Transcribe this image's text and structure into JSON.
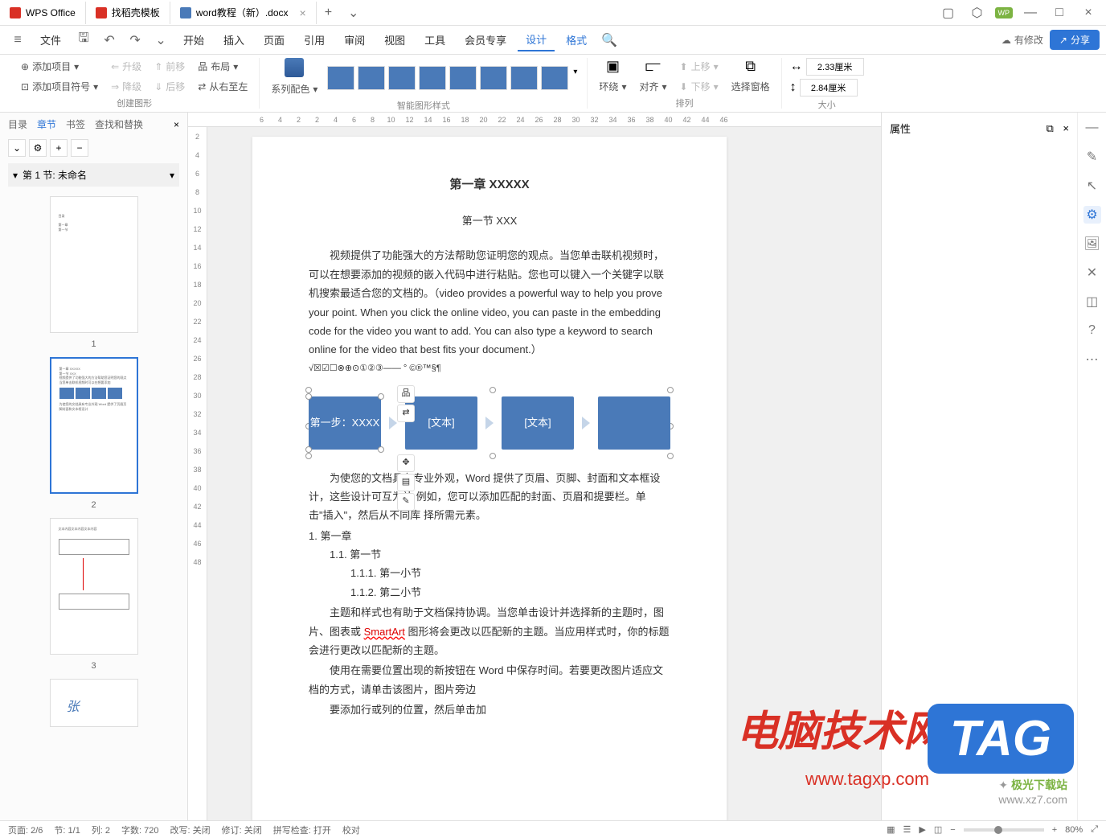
{
  "titlebar": {
    "tabs": [
      {
        "label": "WPS Office",
        "icon": "wps"
      },
      {
        "label": "找稻壳模板",
        "icon": "template"
      },
      {
        "label": "word教程（新）.docx",
        "icon": "word",
        "active": true
      }
    ],
    "wp": "WP"
  },
  "menubar": {
    "file": "文件",
    "items": [
      "开始",
      "插入",
      "页面",
      "引用",
      "审阅",
      "视图",
      "工具",
      "会员专享",
      "设计",
      "格式"
    ],
    "active": "设计",
    "modify": "有修改",
    "share": "分享"
  },
  "ribbon": {
    "group_create": "创建图形",
    "add_item": "添加项目",
    "add_bullet": "添加项目符号",
    "promote": "升级",
    "demote": "降级",
    "move_before": "前移",
    "move_after": "后移",
    "layout": "布局",
    "rtl": "从右至左",
    "group_style": "智能图形样式",
    "series_color": "系列配色",
    "group_arrange": "排列",
    "wrap": "环绕",
    "align": "对齐",
    "move_up": "上移",
    "move_down": "下移",
    "select_pane": "选择窗格",
    "group_size": "大小",
    "width": "2.33厘米",
    "height": "2.84厘米"
  },
  "left_panel": {
    "tabs": [
      "目录",
      "章节",
      "书签",
      "查找和替换"
    ],
    "active": "章节",
    "section1": "第 1 节: 未命名",
    "pages": [
      "1",
      "2",
      "3"
    ]
  },
  "ruler_h": [
    "6",
    "4",
    "2",
    "2",
    "4",
    "6",
    "8",
    "10",
    "12",
    "14",
    "16",
    "18",
    "20",
    "22",
    "24",
    "26",
    "28",
    "30",
    "32",
    "34",
    "36",
    "38",
    "40",
    "42",
    "44",
    "46"
  ],
  "ruler_v": [
    "2",
    "4",
    "6",
    "8",
    "10",
    "12",
    "14",
    "16",
    "18",
    "20",
    "22",
    "24",
    "26",
    "28",
    "30",
    "32",
    "34",
    "36",
    "38",
    "40",
    "42",
    "44",
    "46",
    "48"
  ],
  "doc": {
    "ch1": "第一章 XXXXX",
    "sec1": "第一节 XXX",
    "p1": "视频提供了功能强大的方法帮助您证明您的观点。当您单击联机视频时，可以在想要添加的视频的嵌入代码中进行粘贴。您也可以键入一个关键字以联机搜索最适合您的文档的。（video provides a powerful way to help you prove your point. When you click the online video, you can paste in the embedding code for the video you want to add. You can also type a keyword to search online for the video that best fits your document.）",
    "symbols": "√☒☑☐⊗⊕⊙①②③——  °  ©®™§¶",
    "box1": "第一步：XXXX",
    "box2": "[文本]",
    "box3": "[文本]",
    "p2": "为使您的文档具有专业外观，Word 提供了页眉、页脚、封面和文本框设计，这些设计可互为补    例如，您可以添加匹配的封面、页眉和提要栏。单击\"插入\"，然后从不同库    择所需元素。",
    "l1": "1.  第一章",
    "l11": "1.1. 第一节",
    "l111": "1.1.1. 第一小节",
    "l112": "1.1.2. 第二小节",
    "p3": "主题和样式也有助于文档保持协调。当您单击设计并选择新的主题时，图片、图表或 ",
    "smartart": "SmartArt",
    "p3b": " 图形将会更改以匹配新的主题。当应用样式时，你的标题会进行更改以匹配新的主题。",
    "p4": "使用在需要位置出现的新按钮在 Word 中保存时间。若要更改图片适应文档的方式，请单击该图片，图片旁边",
    "p5": "要添加行或列的位置，然后单击加"
  },
  "right_panel": {
    "title": "属性"
  },
  "statusbar": {
    "page": "页面: 2/6",
    "section": "节: 1/1",
    "col": "列: 2",
    "words": "字数: 720",
    "track": "改写: 关闭",
    "revision": "修订: 关闭",
    "spell": "拼写检查: 打开",
    "proof": "校对",
    "zoom": "80%"
  },
  "watermarks": {
    "w1": "电脑技术网",
    "w1sub": "www.tagxp.com",
    "w2": "TAG",
    "w3a": "极光下载站",
    "w3b": "www.xz7.com"
  }
}
